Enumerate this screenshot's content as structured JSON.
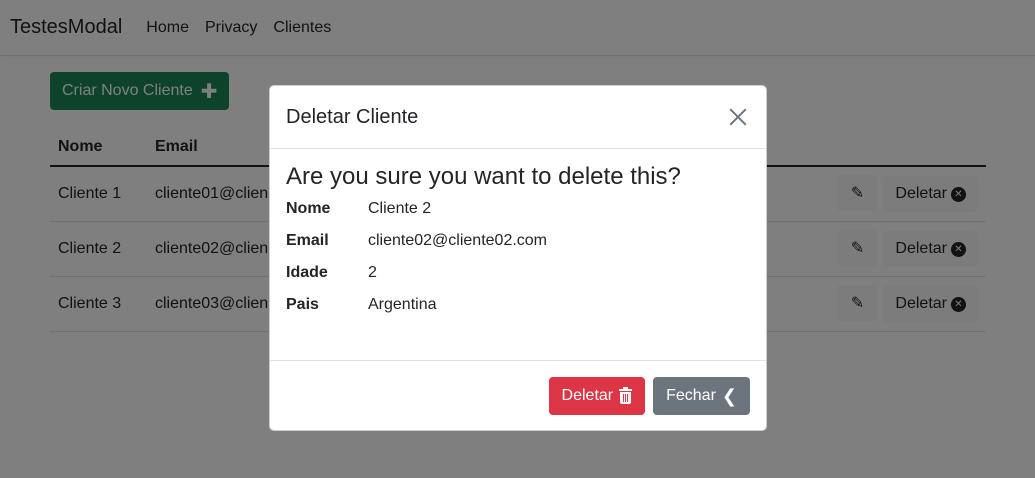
{
  "navbar": {
    "brand": "TestesModal",
    "links": [
      "Home",
      "Privacy",
      "Clientes"
    ]
  },
  "page": {
    "create_button": "Criar Novo Cliente",
    "table": {
      "headers": [
        "Nome",
        "Email"
      ],
      "rows": [
        {
          "name": "Cliente 1",
          "email": "cliente01@clien"
        },
        {
          "name": "Cliente 2",
          "email": "cliente02@clien"
        },
        {
          "name": "Cliente 3",
          "email": "cliente03@clien"
        }
      ],
      "delete_label": "Deletar"
    }
  },
  "modal": {
    "title": "Deletar Cliente",
    "question": "Are you sure you want to delete this?",
    "fields": [
      {
        "label": "Nome",
        "value": "Cliente 2"
      },
      {
        "label": "Email",
        "value": "cliente02@cliente02.com"
      },
      {
        "label": "Idade",
        "value": "2"
      },
      {
        "label": "Pais",
        "value": "Argentina"
      }
    ],
    "delete_button": "Deletar",
    "close_button": "Fechar"
  },
  "colors": {
    "success": "#198754",
    "danger": "#dc3545",
    "secondary": "#6c757d"
  }
}
